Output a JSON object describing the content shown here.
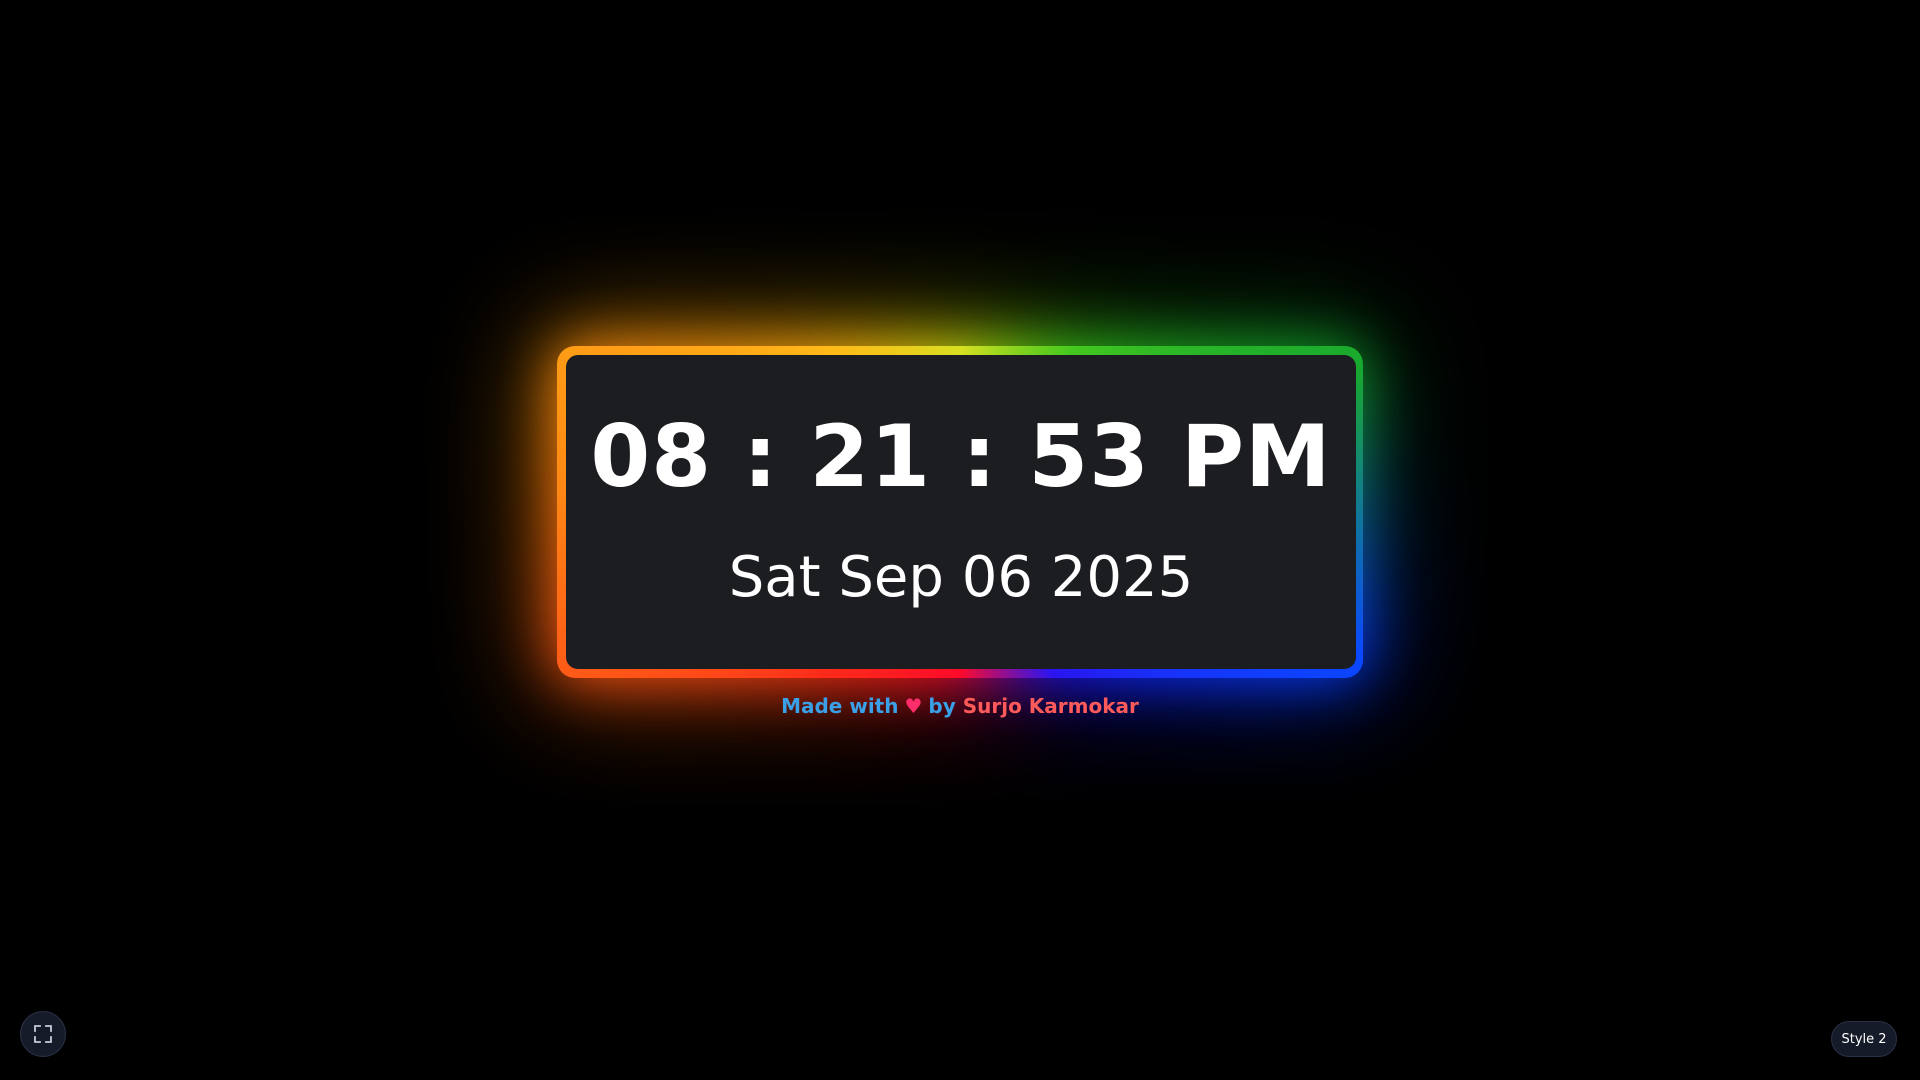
{
  "clock": {
    "time": "08 : 21 : 53 PM",
    "date": "Sat Sep 06 2025"
  },
  "credit": {
    "made_with": "Made with",
    "heart": "♥",
    "by": "by",
    "author": "Surjo Karmokar"
  },
  "controls": {
    "fullscreen_icon": "fullscreen-icon",
    "style_label": "Style 2"
  },
  "colors": {
    "background": "#000000",
    "card": "#1c1d21",
    "credit_blue": "#3aa0e8",
    "credit_author": "#ff5a5a",
    "heart": "#ff2d6a"
  }
}
